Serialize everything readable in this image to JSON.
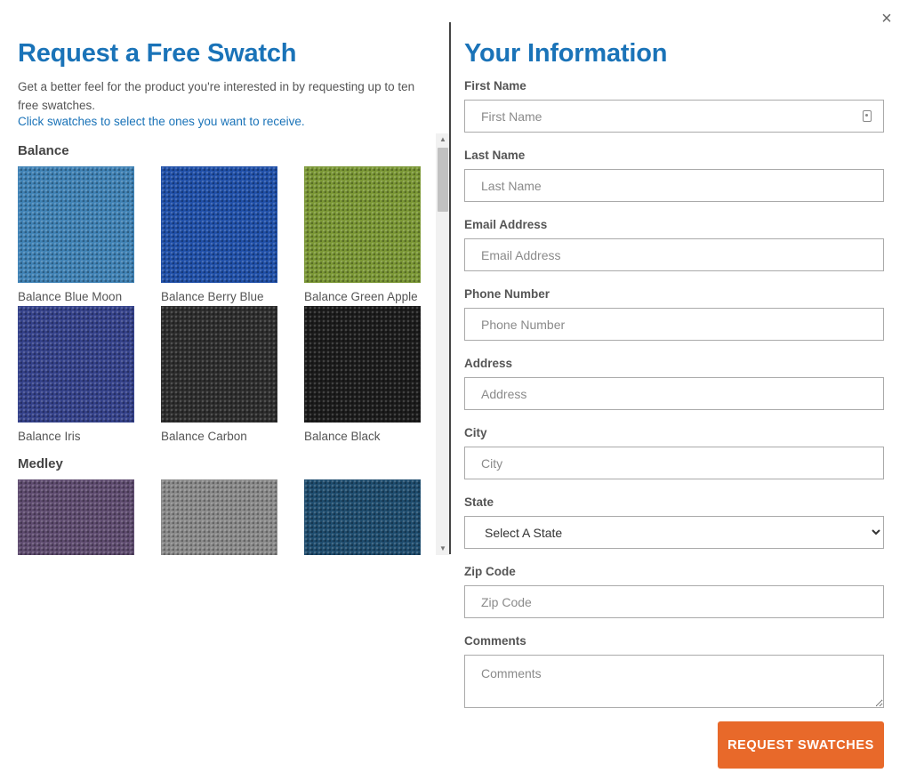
{
  "close_label": "×",
  "left": {
    "title": "Request a Free Swatch",
    "intro": "Get a better feel for the product you're interested in by requesting up to ten free swatches.",
    "intro_link": "Click swatches to select the ones you want to receive.",
    "groups": [
      {
        "name": "Balance",
        "swatches": [
          {
            "name": "Balance Blue Moon",
            "color": "#3f82b5"
          },
          {
            "name": "Balance Berry Blue",
            "color": "#1f4fa8"
          },
          {
            "name": "Balance Green Apple",
            "color": "#7a9734"
          },
          {
            "name": "Balance Iris",
            "color": "#34418a"
          },
          {
            "name": "Balance Carbon",
            "color": "#2c2c2c"
          },
          {
            "name": "Balance Black",
            "color": "#1a1a1a"
          }
        ]
      },
      {
        "name": "Medley",
        "swatches": [
          {
            "name": "",
            "color": "#5e4b6f"
          },
          {
            "name": "",
            "color": "#8a8a8a"
          },
          {
            "name": "",
            "color": "#1d4b6d"
          }
        ]
      }
    ]
  },
  "right": {
    "title": "Your Information",
    "fields": {
      "first_name": {
        "label": "First Name",
        "placeholder": "First Name"
      },
      "last_name": {
        "label": "Last Name",
        "placeholder": "Last Name"
      },
      "email": {
        "label": "Email Address",
        "placeholder": "Email Address"
      },
      "phone": {
        "label": "Phone Number",
        "placeholder": "Phone Number"
      },
      "address": {
        "label": "Address",
        "placeholder": "Address"
      },
      "city": {
        "label": "City",
        "placeholder": "City"
      },
      "state": {
        "label": "State",
        "selected": "Select A State"
      },
      "zip": {
        "label": "Zip Code",
        "placeholder": "Zip Code"
      },
      "comments": {
        "label": "Comments",
        "placeholder": "Comments"
      }
    },
    "submit_label": "REQUEST SWATCHES",
    "accent_color": "#1a73b8",
    "button_color": "#e8692a"
  }
}
